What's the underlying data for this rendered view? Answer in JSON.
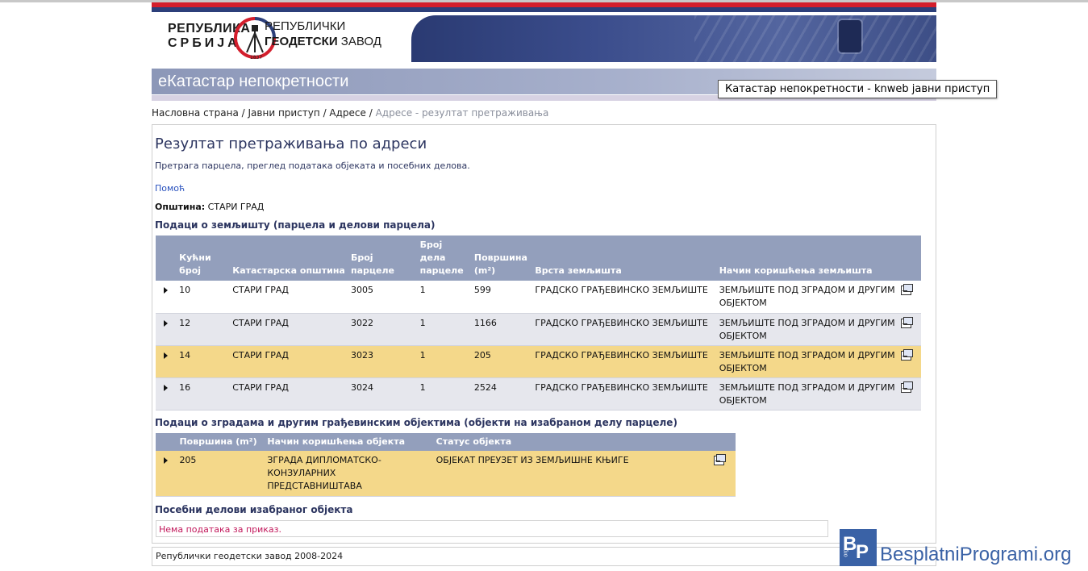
{
  "header": {
    "logo_left_line1": "РЕПУБЛИКА",
    "logo_left_line2": "СРБИЈА",
    "logo_right_line1": "РЕПУБЛИЧКИ",
    "logo_right_line2a": "ГЕОДЕТСКИ",
    "logo_right_line2b": "ЗАВОД",
    "logo_year": "1837",
    "app_title": "еКатастар непокретности"
  },
  "tooltip": "Катастар непокретности - knweb јавни приступ",
  "breadcrumb": {
    "items": [
      "Насловна страна",
      "Јавни приступ",
      "Адресе"
    ],
    "separator": " / ",
    "current": "Адресе - резултат претраживања"
  },
  "page": {
    "title": "Резултат претраживања по адреси",
    "description": "Претрага парцела, преглед података објеката и посебних делова.",
    "help_link": "Помоћ",
    "municipality_label": "Општина:",
    "municipality_value": "СТАРИ ГРАД"
  },
  "land": {
    "heading": "Подаци о земљишту (парцела и делови парцела)",
    "headers": [
      "Кућни број",
      "Катастарска општина",
      "Број парцеле",
      "Број дела парцеле",
      "Површина (m²)",
      "Врста земљишта",
      "Начин коришћења земљишта"
    ],
    "rows": [
      [
        "10",
        "СТАРИ ГРАД",
        "3005",
        "1",
        "599",
        "ГРАДСКО ГРАЂЕВИНСКО ЗЕМЉИШТЕ",
        "ЗЕМЉИШТЕ ПОД ЗГРАДОМ И ДРУГИМ ОБЈЕКТОМ"
      ],
      [
        "12",
        "СТАРИ ГРАД",
        "3022",
        "1",
        "1166",
        "ГРАДСКО ГРАЂЕВИНСКО ЗЕМЉИШТЕ",
        "ЗЕМЉИШТЕ ПОД ЗГРАДОМ И ДРУГИМ ОБЈЕКТОМ"
      ],
      [
        "14",
        "СТАРИ ГРАД",
        "3023",
        "1",
        "205",
        "ГРАДСКО ГРАЂЕВИНСКО ЗЕМЉИШТЕ",
        "ЗЕМЉИШТЕ ПОД ЗГРАДОМ И ДРУГИМ ОБЈЕКТОМ"
      ],
      [
        "16",
        "СТАРИ ГРАД",
        "3024",
        "1",
        "2524",
        "ГРАДСКО ГРАЂЕВИНСКО ЗЕМЉИШТЕ",
        "ЗЕМЉИШТЕ ПОД ЗГРАДОМ И ДРУГИМ ОБЈЕКТОМ"
      ]
    ],
    "selected_row": 2
  },
  "buildings": {
    "heading": "Подаци о зградама и другим грађевинским објектима (објекти на изабраном делу парцеле)",
    "headers": [
      "Површина (m²)",
      "Начин коришћења објекта",
      "Статус објекта"
    ],
    "rows": [
      [
        "205",
        "ЗГРАДА ДИПЛОМАТСКО-КОНЗУЛАРНИХ ПРЕДСТАВНИШТАВА",
        "ОБЈЕКАТ ПРЕУЗЕТ ИЗ ЗЕМЉИШНЕ КЊИГЕ"
      ]
    ]
  },
  "parts": {
    "heading": "Посебни делови изабраног објекта",
    "empty_message": "Нема података за приказ."
  },
  "footer": "Републички геодетски завод 2008-2024",
  "watermark": {
    "badge_b": "B",
    "badge_p": "P",
    "badge_org": "org",
    "text": "BesplatniProgrami.org"
  },
  "colors": {
    "header_row": "#939fbc",
    "row_alt": "#e6e7ed",
    "row_selected": "#f4d88a",
    "heading_text": "#2c3560",
    "empty_text": "#c2185b",
    "brand_red": "#d31e2c",
    "brand_blue": "#2c3f7a"
  },
  "icons": [
    "details-icon",
    "expand-arrow-icon"
  ]
}
